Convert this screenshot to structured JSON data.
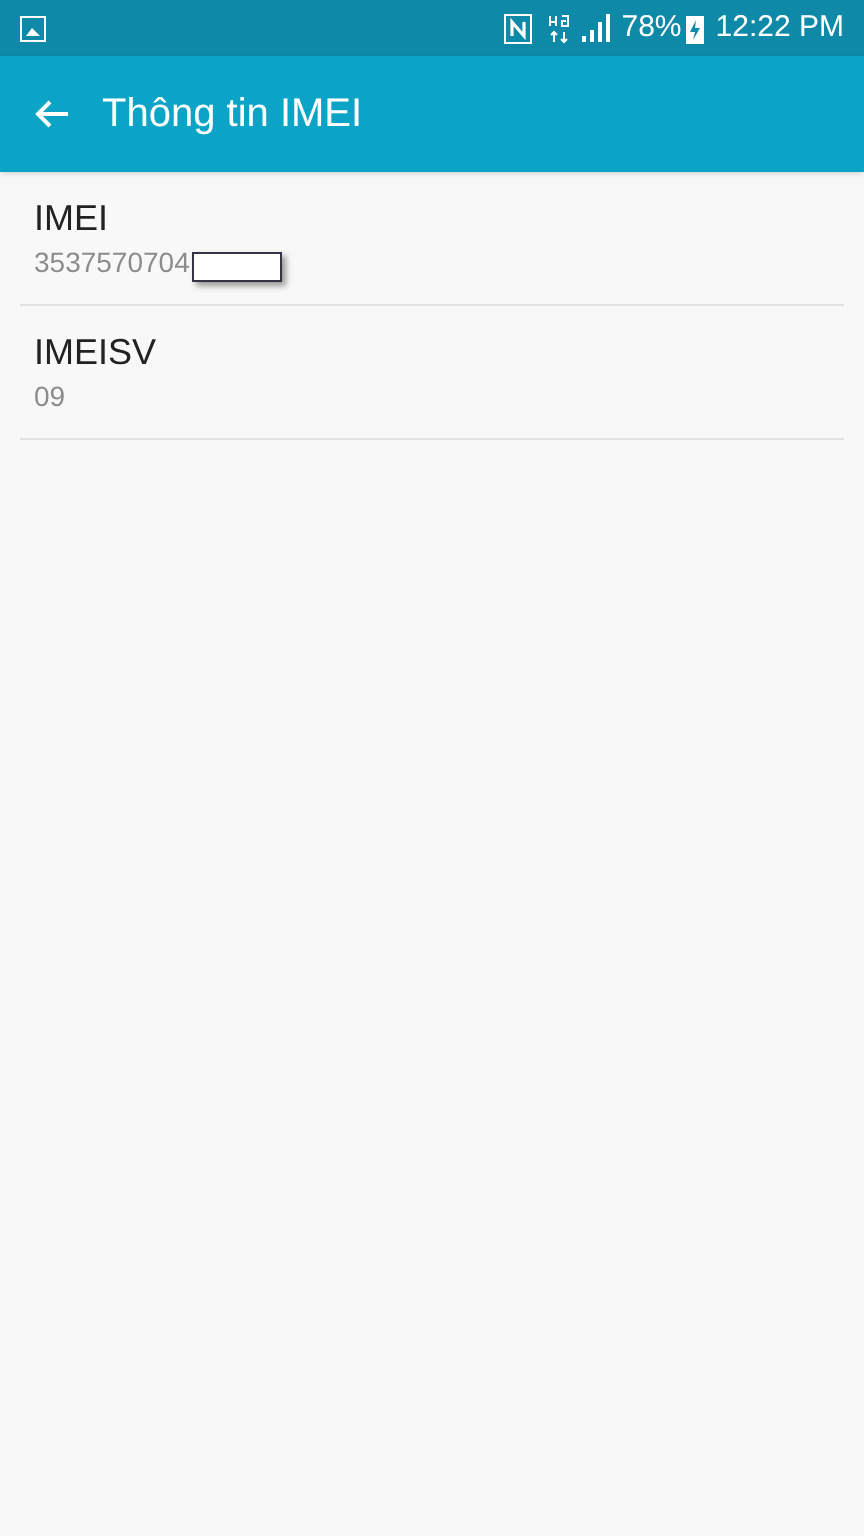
{
  "status_bar": {
    "battery": "78%",
    "time": "12:22 PM"
  },
  "app_bar": {
    "title": "Thông tin IMEI"
  },
  "items": [
    {
      "title": "IMEI",
      "value": "3537570704",
      "redacted": true
    },
    {
      "title": "IMEISV",
      "value": "09",
      "redacted": false
    }
  ]
}
